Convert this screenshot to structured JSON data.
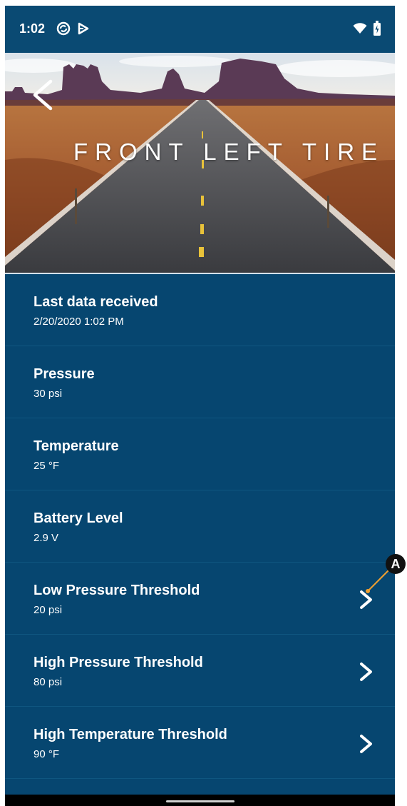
{
  "status_bar": {
    "time": "1:02",
    "icons_left": [
      "sync-icon",
      "cast-icon"
    ],
    "icons_right": [
      "wifi-icon",
      "battery-icon"
    ]
  },
  "header": {
    "title": "FRONT LEFT TIRE",
    "back_icon": "chevron-left-icon"
  },
  "rows": [
    {
      "label": "Last data received",
      "value": "2/20/2020 1:02 PM",
      "has_chevron": false
    },
    {
      "label": "Pressure",
      "value": "30 psi",
      "has_chevron": false
    },
    {
      "label": "Temperature",
      "value": "25 °F",
      "has_chevron": false
    },
    {
      "label": "Battery Level",
      "value": "2.9 V",
      "has_chevron": false
    },
    {
      "label": "Low Pressure Threshold",
      "value": "20 psi",
      "has_chevron": true
    },
    {
      "label": "High Pressure Threshold",
      "value": "80 psi",
      "has_chevron": true
    },
    {
      "label": "High Temperature Threshold",
      "value": "90 °F",
      "has_chevron": true
    }
  ],
  "annotation": {
    "label": "A"
  },
  "colors": {
    "background": "#064670",
    "status_bar": "#0a4a73",
    "text": "#ffffff",
    "divider": "#0f5680",
    "annotation_line": "#f0a030"
  }
}
